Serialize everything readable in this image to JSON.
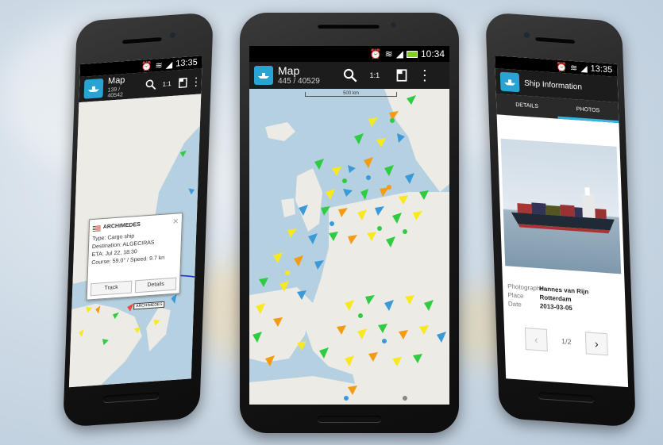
{
  "center_phone": {
    "time": "10:34",
    "app_title": "Map",
    "vessel_count": "445 / 40529",
    "zoom_label": "1:1",
    "scale_label": "500 km"
  },
  "left_phone": {
    "time": "13:35",
    "app_title": "Map",
    "vessel_count": "139 / 40542",
    "zoom_label": "1:1",
    "popup": {
      "ship_name": "ARCHIMEDES",
      "type_line": "Type: Cargo ship",
      "destination_line": "Destination: ALGECIRAS",
      "eta_line": "ETA: Jul 22, 18:30",
      "speed_line": "Course: 59.0° / Speed: 9.7 kn",
      "track_button": "Track",
      "details_button": "Details"
    },
    "ship_label": "ARCHIMEDES"
  },
  "right_phone": {
    "time": "13:35",
    "screen_title": "Ship Information",
    "tabs": [
      "DETAILS",
      "PHOTOS"
    ],
    "photographer_label": "Photographer",
    "photographer_value": "Hannes van Rijn",
    "place_label": "Place",
    "place_value": "Rotterdam",
    "date_label": "Date",
    "date_value": "2013-03-05",
    "pager_text": "1/2"
  },
  "colors": {
    "accent": "#33b5e5",
    "app_icon": "#29a3d4",
    "sea": "#b5d0e0",
    "land": "#ecebe6"
  }
}
